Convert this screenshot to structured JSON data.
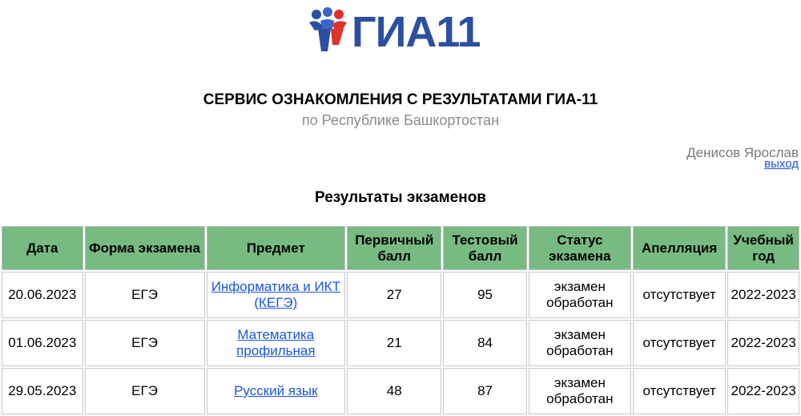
{
  "header": {
    "logo_text": "ГИА11",
    "title": "СЕРВИС ОЗНАКОМЛЕНИЯ С РЕЗУЛЬТАТАМИ ГИА-11",
    "subtitle": "по Республике Башкортостан"
  },
  "user": {
    "name": "Денисов Ярослав",
    "logout_label": "выход"
  },
  "results": {
    "title": "Результаты экзаменов",
    "columns": {
      "date": "Дата",
      "form": "Форма экзамена",
      "subject": "Предмет",
      "primary": "Первичный балл",
      "test": "Тестовый балл",
      "status": "Статус экзамена",
      "appeal": "Апелляция",
      "year": "Учебный год"
    },
    "rows": [
      {
        "date": "20.06.2023",
        "form": "ЕГЭ",
        "subject": "Информатика и ИКТ (КЕГЭ)",
        "primary": "27",
        "test": "95",
        "status": "экзамен обработан",
        "appeal": "отсутствует",
        "year": "2022-2023"
      },
      {
        "date": "01.06.2023",
        "form": "ЕГЭ",
        "subject": "Математика профильная",
        "primary": "21",
        "test": "84",
        "status": "экзамен обработан",
        "appeal": "отсутствует",
        "year": "2022-2023"
      },
      {
        "date": "29.05.2023",
        "form": "ЕГЭ",
        "subject": "Русский язык",
        "primary": "48",
        "test": "87",
        "status": "экзамен обработан",
        "appeal": "отсутствует",
        "year": "2022-2023"
      }
    ]
  },
  "colors": {
    "header_bg": "#77bb82",
    "link": "#1a56e0",
    "logo_blue": "#2d4fa0",
    "logo_red": "#e0312b"
  },
  "icons": {
    "logo": "people-figures-logo-icon"
  }
}
